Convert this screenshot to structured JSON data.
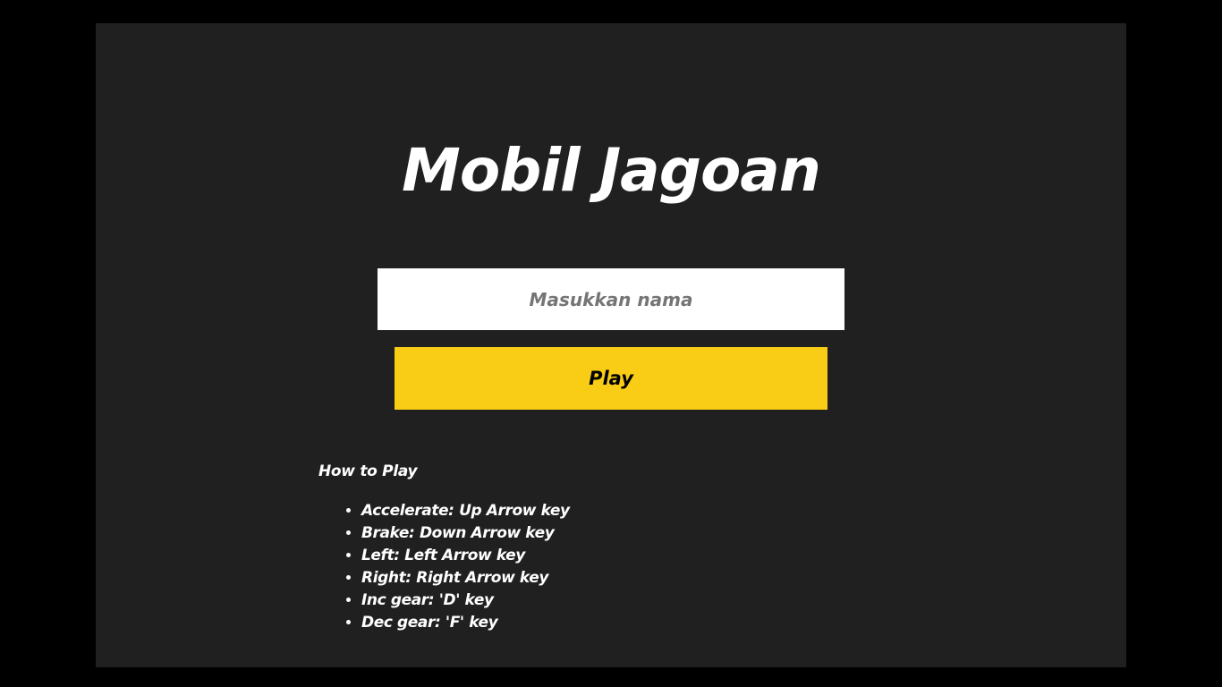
{
  "game": {
    "title": "Mobil Jagoan",
    "name_input": {
      "value": "",
      "placeholder": "Masukkan nama"
    },
    "play_label": "Play",
    "how_to_play": {
      "heading": "How to Play",
      "controls": [
        "Accelerate: Up Arrow key",
        "Brake: Down Arrow key",
        "Left: Left Arrow key",
        "Right: Right Arrow key",
        "Inc gear: 'D' key",
        "Dec gear: 'F' key"
      ]
    }
  },
  "colors": {
    "page_background": "#000000",
    "frame_background": "#202020",
    "title_text": "#ffffff",
    "input_background": "#ffffff",
    "placeholder_text": "#757575",
    "play_button": "#f9cd16",
    "play_text": "#000000"
  }
}
